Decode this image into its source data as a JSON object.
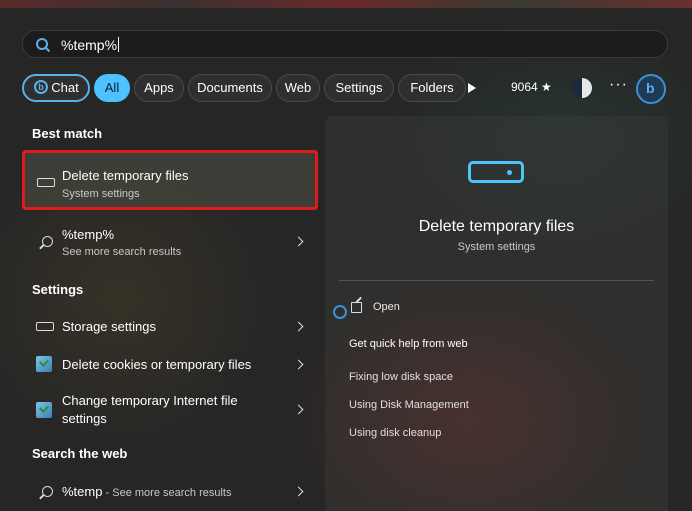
{
  "search": {
    "query": "%temp%"
  },
  "filters": {
    "chat": "Chat",
    "all": "All",
    "apps": "Apps",
    "documents": "Documents",
    "web": "Web",
    "settings": "Settings",
    "folders": "Folders",
    "points": "9064"
  },
  "left": {
    "best_match_header": "Best match",
    "best_match": {
      "title": "Delete temporary files",
      "subtitle": "System settings"
    },
    "search_more": {
      "title": "%temp%",
      "subtitle": "See more search results"
    },
    "settings_header": "Settings",
    "settings_items": [
      {
        "label": "Storage settings"
      },
      {
        "label": "Delete cookies or temporary files"
      },
      {
        "label_line1": "Change temporary Internet file",
        "label_line2": "settings"
      }
    ],
    "web_header": "Search the web",
    "web_item": {
      "query": "%temp",
      "suffix": " - See more search results"
    }
  },
  "right": {
    "title": "Delete temporary files",
    "subtitle": "System settings",
    "open_label": "Open",
    "quick_help": "Get quick help from web",
    "links": [
      "Fixing low disk space",
      "Using Disk Management",
      "Using disk cleanup"
    ]
  },
  "colors": {
    "accent": "#4cc2ff",
    "highlight_border": "#e01b1b"
  }
}
